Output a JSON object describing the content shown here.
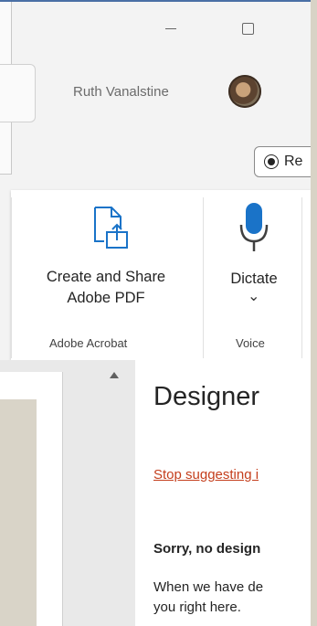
{
  "account": {
    "user_name": "Ruth Vanalstine"
  },
  "header": {
    "record_label": "Re"
  },
  "ribbon": {
    "acrobat": {
      "line1": "Create and Share",
      "line2": "Adobe PDF",
      "group_label": "Adobe Acrobat"
    },
    "voice": {
      "dictate_label": "Dictate",
      "chevron": "⌄",
      "group_label": "Voice"
    }
  },
  "designer_pane": {
    "title": "Designer",
    "stop_link": "Stop suggesting i",
    "sorry_text": "Sorry, no design",
    "body_line1": "When we have de",
    "body_line2": "you right here."
  },
  "colors": {
    "link": "#c43e1c",
    "icon_blue": "#1a73c8",
    "window_border": "#4a6fa5"
  }
}
